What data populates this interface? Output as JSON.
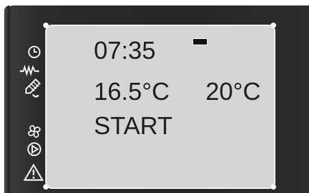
{
  "display": {
    "time": "07:35",
    "current_temp": "16.5°C",
    "set_temp": "20°C",
    "status": "START"
  },
  "icons": [
    "clock-icon",
    "heating-icon",
    "glove-icon",
    "fan-icon",
    "play-icon",
    "warning-icon"
  ],
  "colors": {
    "lcd_background": "#d5d5d5",
    "lcd_text": "#1e1e1e",
    "bezel": "#2a2a2a",
    "icon": "#f2f2f2"
  }
}
